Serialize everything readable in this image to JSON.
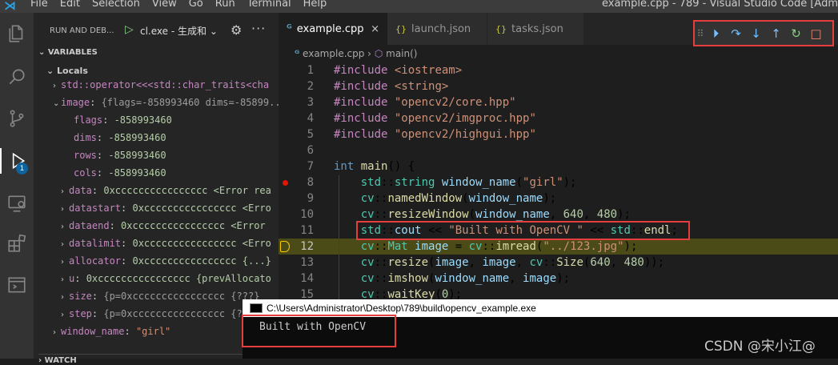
{
  "titlebar": {
    "menu": [
      "File",
      "Edit",
      "Selection",
      "View",
      "Go",
      "Run",
      "Terminal",
      "Help"
    ],
    "title": "example.cpp - 789 - Visual Studio Code [Adm"
  },
  "activity": {
    "debug_badge": "1"
  },
  "runbar": {
    "title": "RUN AND DEB...",
    "config": "cl.exe - 生成和"
  },
  "variables": {
    "header": "VARIABLES",
    "locals_header": "Locals",
    "rows": [
      {
        "name": "std::operator<<<std::char_traits<cha",
        "val": "",
        "twisty": "›"
      },
      {
        "name": "image",
        "val": "{flags=-858993460 dims=-85899...",
        "twisty": "⌄"
      },
      {
        "name": "flags",
        "val": "-858993460",
        "twisty": ""
      },
      {
        "name": "dims",
        "val": "-858993460",
        "twisty": ""
      },
      {
        "name": "rows",
        "val": "-858993460",
        "twisty": ""
      },
      {
        "name": "cols",
        "val": "-858993460",
        "twisty": ""
      },
      {
        "name": "data",
        "val": "0xcccccccccccccccc <Error rea",
        "twisty": "›"
      },
      {
        "name": "datastart",
        "val": "0xcccccccccccccccc <Erro",
        "twisty": "›"
      },
      {
        "name": "dataend",
        "val": "0xcccccccccccccccc <Error",
        "twisty": "›"
      },
      {
        "name": "datalimit",
        "val": "0xcccccccccccccccc <Erro",
        "twisty": "›"
      },
      {
        "name": "allocator",
        "val": "0xcccccccccccccccc {...}",
        "twisty": "›"
      },
      {
        "name": "u",
        "val": "0xcccccccccccccccc {prevAllocato",
        "twisty": "›"
      },
      {
        "name": "size",
        "val": "{p=0xcccccccccccccccc {???}",
        "twisty": "›"
      },
      {
        "name": "step",
        "val": "{p=0xcccccccccccccccc {???}",
        "twisty": "›"
      },
      {
        "name": "window_name",
        "val": "\"girl\"",
        "twisty": "›"
      }
    ],
    "watch_header": "WATCH"
  },
  "tabs": [
    {
      "label": "example.cpp",
      "icon": "C++",
      "close": "×"
    },
    {
      "label": "launch.json",
      "icon": "{}"
    },
    {
      "label": "tasks.json",
      "icon": "{}"
    }
  ],
  "breadcrumb": {
    "file": "example.cpp",
    "sep": "›",
    "symbol": "main()"
  },
  "code_lines": [
    {
      "n": "1",
      "html": "<span class=\"pp\">#include</span> <span class=\"str\">&lt;iostream&gt;</span>"
    },
    {
      "n": "2",
      "html": "<span class=\"pp\">#include</span> <span class=\"str\">&lt;string&gt;</span>"
    },
    {
      "n": "3",
      "html": "<span class=\"pp\">#include</span> <span class=\"str\">\"opencv2/core.hpp\"</span>"
    },
    {
      "n": "4",
      "html": "<span class=\"pp\">#include</span> <span class=\"str\">\"opencv2/imgproc.hpp\"</span>"
    },
    {
      "n": "5",
      "html": "<span class=\"pp\">#include</span> <span class=\"str\">\"opencv2/highgui.hpp\"</span>"
    },
    {
      "n": "6",
      "html": ""
    },
    {
      "n": "7",
      "html": "<span class=\"kw\">int</span> <span class=\"fn\">main</span>() {"
    },
    {
      "n": "8",
      "html": "    <span class=\"ns\">std</span>::<span class=\"ns\">string</span> <span class=\"var\">window_name</span>(<span class=\"str\">\"girl\"</span>);"
    },
    {
      "n": "9",
      "html": "    <span class=\"ns\">cv</span>::<span class=\"fn\">namedWindow</span>(<span class=\"var\">window_name</span>);"
    },
    {
      "n": "10",
      "html": "    <span class=\"ns\">cv</span>::<span class=\"fn\">resizeWindow</span>(<span class=\"var\">window_name</span>, <span class=\"num\">640</span>, <span class=\"num\">480</span>);"
    },
    {
      "n": "11",
      "html": "    <span class=\"ns\">std</span>::<span class=\"var\">cout</span> &lt;&lt; <span class=\"str\">\"Built with OpenCV \"</span> &lt;&lt; <span class=\"ns\">std</span>::<span class=\"fn\">endl</span>;"
    },
    {
      "n": "12",
      "html": "    <span class=\"ns\">cv</span>::<span class=\"ns\">Mat</span> <span class=\"var\">image</span> = <span class=\"ns\">cv</span>::<span class=\"fn\">imread</span>(<span class=\"str\">\"../123.jpg\"</span>);"
    },
    {
      "n": "13",
      "html": "    <span class=\"ns\">cv</span>::<span class=\"fn\">resize</span>(<span class=\"var\">image</span>, <span class=\"var\">image</span>, <span class=\"ns\">cv</span>::<span class=\"fn\">Size</span>(<span class=\"num\">640</span>, <span class=\"num\">480</span>));"
    },
    {
      "n": "14",
      "html": "    <span class=\"ns\">cv</span>::<span class=\"fn\">imshow</span>(<span class=\"var\">window_name</span>, <span class=\"var\">image</span>);"
    },
    {
      "n": "15",
      "html": "    <span class=\"ns\">cv</span>::<span class=\"fn\">waitKey</span>(<span class=\"num\">0</span>);"
    }
  ],
  "console": {
    "title": "C:\\Users\\Administrator\\Desktop\\789\\build\\opencv_example.exe",
    "output": "Built with OpenCV"
  },
  "watermark": "CSDN @宋小江@"
}
